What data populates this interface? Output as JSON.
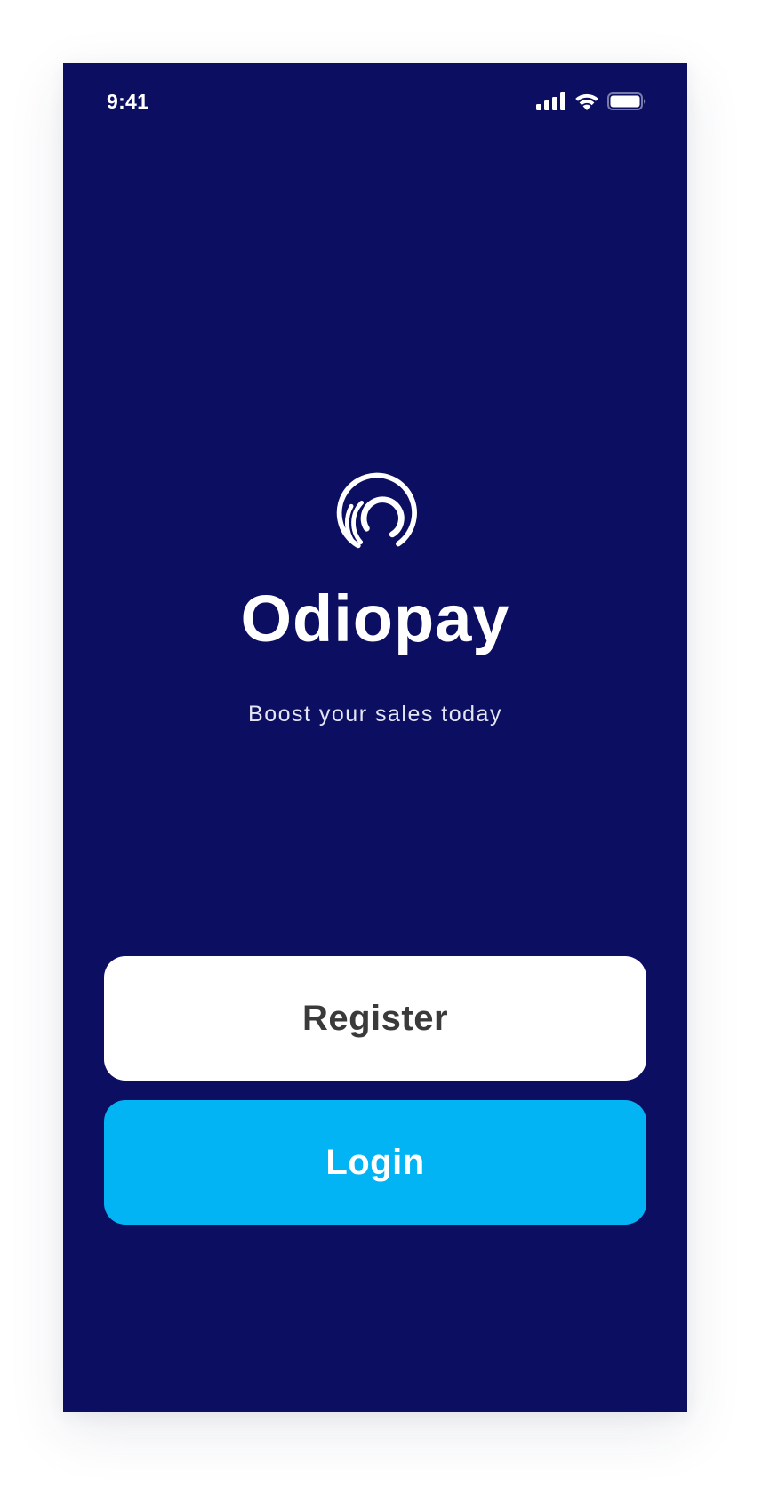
{
  "status_bar": {
    "time": "9:41",
    "icons": [
      "cellular-signal-icon",
      "wifi-icon",
      "battery-icon"
    ]
  },
  "brand": {
    "logo_icon": "odiopay-logo-icon",
    "name": "Odiopay",
    "tagline": "Boost your sales today"
  },
  "actions": {
    "register_label": "Register",
    "login_label": "Login"
  },
  "colors": {
    "background": "#0c0e62",
    "register_button": "#ffffff",
    "register_text": "#3a3a3a",
    "login_button": "#02b4f3",
    "login_text": "#ffffff"
  }
}
